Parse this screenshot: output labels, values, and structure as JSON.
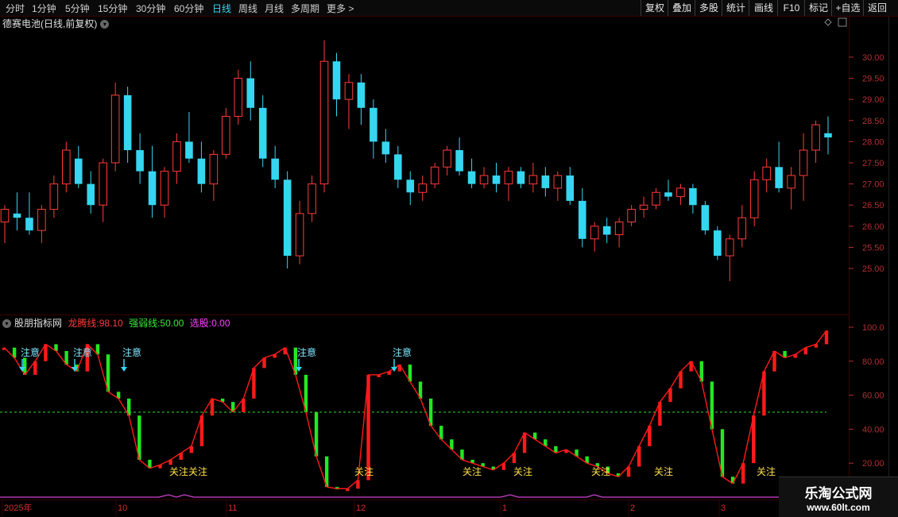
{
  "toolbar": {
    "periods": [
      "分时",
      "1分钟",
      "5分钟",
      "15分钟",
      "30分钟",
      "60分钟",
      "日线",
      "周线",
      "月线",
      "多周期",
      "更多 >"
    ],
    "active_period": "日线",
    "right_buttons": [
      "复权",
      "叠加",
      "多股",
      "统计",
      "画线",
      "F10",
      "标记",
      "+自选",
      "返回"
    ]
  },
  "main_chart": {
    "title": "德赛电池(日线,前复权)",
    "price_ticks": [
      "30.00",
      "29.50",
      "29.00",
      "28.50",
      "28.00",
      "27.50",
      "27.00",
      "26.50",
      "26.00",
      "25.50",
      "25.00"
    ]
  },
  "indicator": {
    "name": "股朋指标网",
    "line1_label": "龙腾线:",
    "line1_value": "98.10",
    "line2_label": "强弱线:",
    "line2_value": "50.00",
    "line3_label": "选股:",
    "line3_value": "0.00",
    "ticks": [
      "100.0",
      "80.00",
      "60.00",
      "40.00",
      "20.00"
    ],
    "signal_attention": "注意",
    "signal_focus": "关注"
  },
  "dates": [
    "2025年",
    "10",
    "11",
    "12",
    "1",
    "2",
    "3"
  ],
  "watermark": {
    "title": "乐淘公式网",
    "url": "www.60lt.com"
  },
  "colors": {
    "up": "#ff3b3b",
    "down": "#35d6f0",
    "ind_up": "#ff1a1a",
    "ind_down": "#22e822",
    "axis": "#b03030",
    "grid": "#3a0000"
  },
  "chart_data": {
    "type": "candlestick",
    "ylim": [
      24.4,
      30.6
    ],
    "candles": [
      [
        26.1,
        26.5,
        25.6,
        26.4
      ],
      [
        26.3,
        26.8,
        25.9,
        26.2
      ],
      [
        26.2,
        26.8,
        25.8,
        25.9
      ],
      [
        25.9,
        26.5,
        25.6,
        26.4
      ],
      [
        26.4,
        27.2,
        26.2,
        27.0
      ],
      [
        27.0,
        28.0,
        26.8,
        27.8
      ],
      [
        27.6,
        27.9,
        26.9,
        27.0
      ],
      [
        27.0,
        27.3,
        26.3,
        26.5
      ],
      [
        26.5,
        27.6,
        26.1,
        27.5
      ],
      [
        27.5,
        29.4,
        27.3,
        29.1
      ],
      [
        29.1,
        29.3,
        27.5,
        27.8
      ],
      [
        27.8,
        28.2,
        27.0,
        27.3
      ],
      [
        27.3,
        27.9,
        26.2,
        26.5
      ],
      [
        26.5,
        27.4,
        26.2,
        27.3
      ],
      [
        27.3,
        28.2,
        27.0,
        28.0
      ],
      [
        28.0,
        28.7,
        27.5,
        27.6
      ],
      [
        27.6,
        28.0,
        26.8,
        27.0
      ],
      [
        27.0,
        27.8,
        26.6,
        27.7
      ],
      [
        27.7,
        28.8,
        27.6,
        28.6
      ],
      [
        28.6,
        29.7,
        28.4,
        29.5
      ],
      [
        29.5,
        29.9,
        28.5,
        28.8
      ],
      [
        28.8,
        29.1,
        27.4,
        27.6
      ],
      [
        27.6,
        27.9,
        26.9,
        27.1
      ],
      [
        27.1,
        27.3,
        25.0,
        25.3
      ],
      [
        25.3,
        26.6,
        25.1,
        26.3
      ],
      [
        26.3,
        27.2,
        26.1,
        27.0
      ],
      [
        27.0,
        30.4,
        26.8,
        29.9
      ],
      [
        29.9,
        30.1,
        28.6,
        29.0
      ],
      [
        29.0,
        29.6,
        28.3,
        29.4
      ],
      [
        29.4,
        29.6,
        28.4,
        28.8
      ],
      [
        28.8,
        29.0,
        27.6,
        28.0
      ],
      [
        28.0,
        28.3,
        27.5,
        27.7
      ],
      [
        27.7,
        27.9,
        26.9,
        27.1
      ],
      [
        27.1,
        27.3,
        26.5,
        26.8
      ],
      [
        26.8,
        27.2,
        26.6,
        27.0
      ],
      [
        27.0,
        27.5,
        26.9,
        27.4
      ],
      [
        27.4,
        27.9,
        27.2,
        27.8
      ],
      [
        27.8,
        28.1,
        27.2,
        27.3
      ],
      [
        27.3,
        27.6,
        26.9,
        27.0
      ],
      [
        27.0,
        27.4,
        26.9,
        27.2
      ],
      [
        27.2,
        27.5,
        26.8,
        27.0
      ],
      [
        27.0,
        27.4,
        26.6,
        27.3
      ],
      [
        27.3,
        27.4,
        26.9,
        27.0
      ],
      [
        27.0,
        27.5,
        26.8,
        27.2
      ],
      [
        27.2,
        27.4,
        26.7,
        26.9
      ],
      [
        26.9,
        27.3,
        26.6,
        27.2
      ],
      [
        27.2,
        27.4,
        26.5,
        26.6
      ],
      [
        26.6,
        26.9,
        25.5,
        25.7
      ],
      [
        25.7,
        26.1,
        25.4,
        26.0
      ],
      [
        26.0,
        26.2,
        25.6,
        25.8
      ],
      [
        25.8,
        26.2,
        25.5,
        26.1
      ],
      [
        26.1,
        26.5,
        26.0,
        26.4
      ],
      [
        26.4,
        26.7,
        26.2,
        26.5
      ],
      [
        26.5,
        26.9,
        26.4,
        26.8
      ],
      [
        26.8,
        27.1,
        26.6,
        26.7
      ],
      [
        26.7,
        27.0,
        26.5,
        26.9
      ],
      [
        26.9,
        27.0,
        26.3,
        26.5
      ],
      [
        26.5,
        26.6,
        25.8,
        25.9
      ],
      [
        25.9,
        26.0,
        25.2,
        25.3
      ],
      [
        25.3,
        25.8,
        24.7,
        25.7
      ],
      [
        25.7,
        26.5,
        25.5,
        26.2
      ],
      [
        26.2,
        27.3,
        26.0,
        27.1
      ],
      [
        27.1,
        27.6,
        26.8,
        27.4
      ],
      [
        27.4,
        28.0,
        26.8,
        26.9
      ],
      [
        26.9,
        27.4,
        26.4,
        27.2
      ],
      [
        27.2,
        28.2,
        26.6,
        27.8
      ],
      [
        27.8,
        28.5,
        27.5,
        28.4
      ],
      [
        28.2,
        28.6,
        27.7,
        28.1
      ]
    ],
    "indicator_values": [
      88,
      82,
      72,
      80,
      90,
      86,
      78,
      74,
      90,
      84,
      62,
      58,
      48,
      22,
      17,
      19,
      22,
      26,
      30,
      48,
      58,
      56,
      50,
      58,
      76,
      82,
      84,
      88,
      72,
      50,
      24,
      6,
      5,
      5,
      10,
      72,
      72,
      74,
      78,
      68,
      58,
      42,
      34,
      28,
      22,
      20,
      18,
      16,
      20,
      26,
      38,
      34,
      30,
      26,
      28,
      24,
      20,
      18,
      14,
      12,
      18,
      30,
      42,
      56,
      64,
      74,
      80,
      68,
      40,
      12,
      8,
      20,
      48,
      74,
      86,
      82,
      84,
      88,
      90,
      98
    ]
  }
}
